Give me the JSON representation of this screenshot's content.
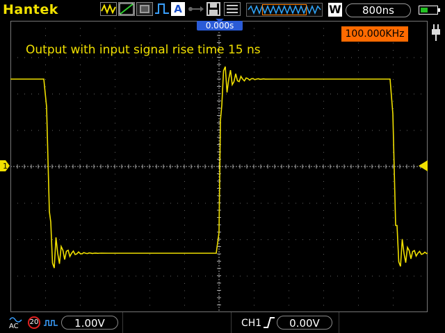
{
  "brand": "Hantek",
  "header": {
    "timebase": "800ns",
    "mode_letter": "W",
    "icons": [
      "waveform-mode-icon",
      "ramp-icon",
      "persist-icon",
      "pulse-icon",
      "auto-icon",
      "usb-icon",
      "save-icon",
      "menu-icon",
      "memory-track-icon",
      "battery-icon"
    ]
  },
  "screen": {
    "trigger_position": "0.000s",
    "frequency": "100.000KHz",
    "caption": "Output with input signal rise time 15 ns",
    "ch1_marker": "1"
  },
  "footer": {
    "coupling": "AC",
    "bandwidth_limit": "20",
    "ch1_volts_div": "1.00V",
    "trigger_channel": "CH1",
    "trigger_level": "0.00V"
  },
  "colors": {
    "trace": "#f0e000",
    "accent_orange": "#ff6a00",
    "trigger_blue": "#2a5bd7"
  }
}
